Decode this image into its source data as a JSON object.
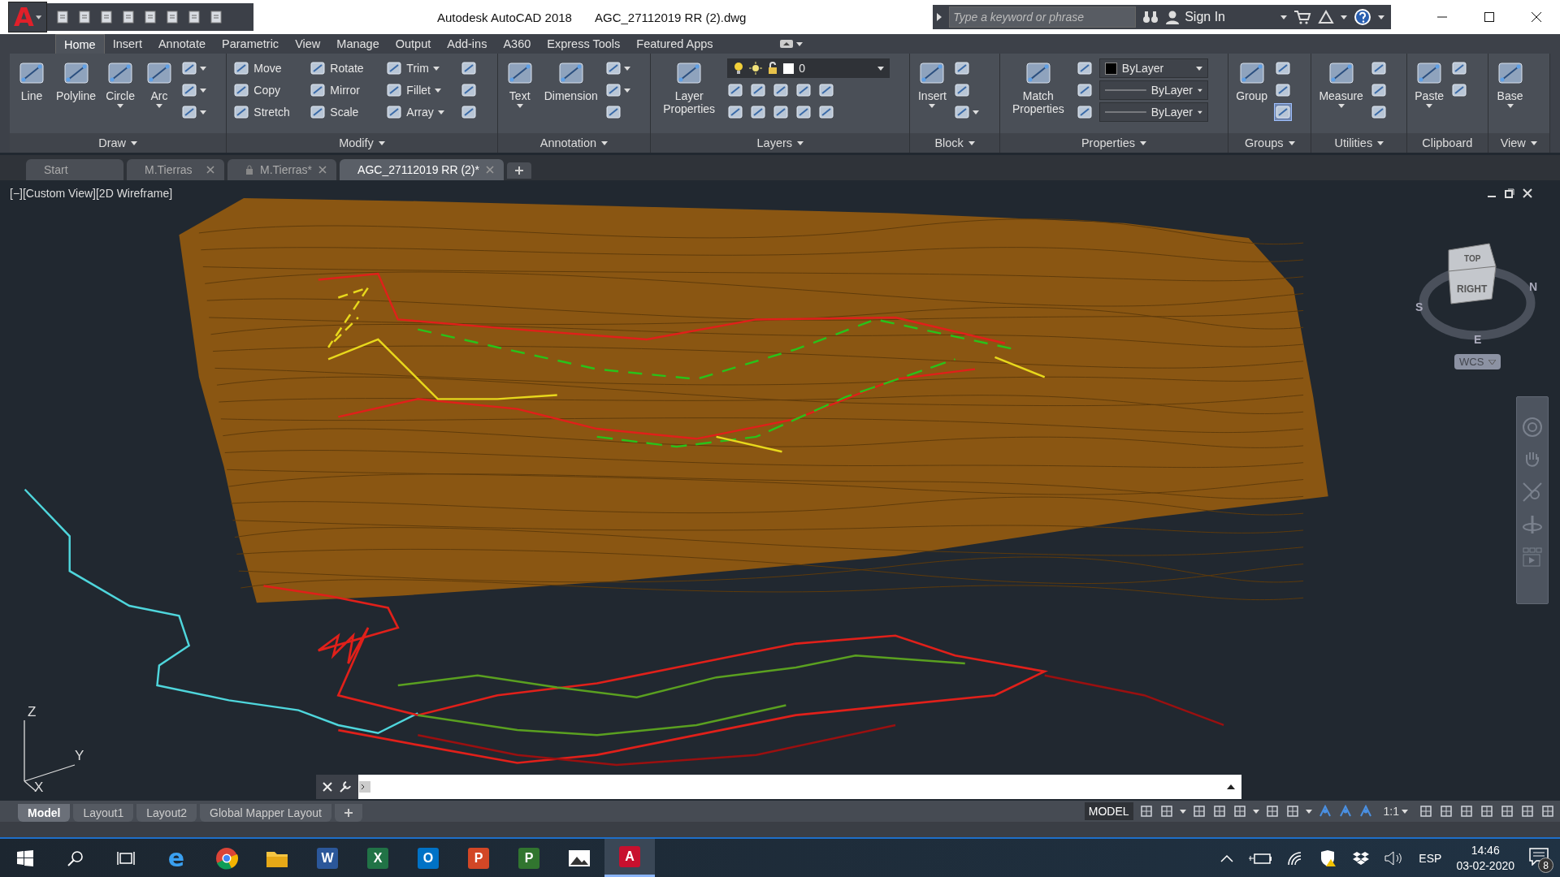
{
  "app_menu": {
    "letter": "A"
  },
  "window": {
    "title": "Autodesk AutoCAD 2018",
    "file": "AGC_27112019 RR (2).dwg"
  },
  "search": {
    "placeholder": "Type a keyword or phrase"
  },
  "account": {
    "label": "Sign In"
  },
  "ribbon_tabs": [
    {
      "label": "Home",
      "selected": true
    },
    {
      "label": "Insert",
      "selected": false
    },
    {
      "label": "Annotate",
      "selected": false
    },
    {
      "label": "Parametric",
      "selected": false
    },
    {
      "label": "View",
      "selected": false
    },
    {
      "label": "Manage",
      "selected": false
    },
    {
      "label": "Output",
      "selected": false
    },
    {
      "label": "Add-ins",
      "selected": false
    },
    {
      "label": "A360",
      "selected": false
    },
    {
      "label": "Express Tools",
      "selected": false
    },
    {
      "label": "Featured Apps",
      "selected": false
    }
  ],
  "ribbon_panels": [
    {
      "title": "Draw",
      "has_menu": true,
      "large": [
        {
          "label": "Line",
          "has_menu": false
        },
        {
          "label": "Polyline",
          "has_menu": false
        },
        {
          "label": "Circle",
          "has_menu": true
        },
        {
          "label": "Arc",
          "has_menu": true
        }
      ],
      "rows": [
        [
          {
            "kind": "icon",
            "has_menu": true
          }
        ],
        [
          {
            "kind": "icon",
            "has_menu": true
          }
        ],
        [
          {
            "kind": "icon",
            "has_menu": true
          }
        ]
      ]
    },
    {
      "title": "Modify",
      "has_menu": true,
      "rows": [
        [
          {
            "kind": "small",
            "label": "Move",
            "has_menu": false
          },
          {
            "kind": "small",
            "label": "Rotate",
            "has_menu": false
          },
          {
            "kind": "small",
            "label": "Trim",
            "has_menu": true
          },
          {
            "kind": "icon",
            "has_menu": false
          }
        ],
        [
          {
            "kind": "small",
            "label": "Copy",
            "has_menu": false
          },
          {
            "kind": "small",
            "label": "Mirror",
            "has_menu": false
          },
          {
            "kind": "small",
            "label": "Fillet",
            "has_menu": true
          },
          {
            "kind": "icon",
            "has_menu": false
          }
        ],
        [
          {
            "kind": "small",
            "label": "Stretch",
            "has_menu": false
          },
          {
            "kind": "small",
            "label": "Scale",
            "has_menu": false
          },
          {
            "kind": "small",
            "label": "Array",
            "has_menu": true
          },
          {
            "kind": "icon",
            "has_menu": false
          }
        ]
      ]
    },
    {
      "title": "Annotation",
      "has_menu": true,
      "large": [
        {
          "label": "Text",
          "has_menu": true
        },
        {
          "label": "Dimension",
          "has_menu": false
        }
      ],
      "rows": [
        [
          {
            "kind": "icon",
            "has_menu": true
          }
        ],
        [
          {
            "kind": "icon",
            "has_menu": true
          }
        ],
        [
          {
            "kind": "icon",
            "has_menu": false
          }
        ]
      ]
    },
    {
      "title": "Layers",
      "has_menu": true,
      "large": [
        {
          "label": "Layer Properties",
          "has_menu": false
        }
      ],
      "rows": [
        [
          {
            "kind": "layer_dropdown",
            "value": "0"
          }
        ],
        [
          {
            "kind": "icon",
            "has_menu": false
          },
          {
            "kind": "icon",
            "has_menu": false
          },
          {
            "kind": "icon",
            "has_menu": false
          },
          {
            "kind": "icon",
            "has_menu": false
          },
          {
            "kind": "icon",
            "has_menu": false
          }
        ],
        [
          {
            "kind": "icon",
            "has_menu": false
          },
          {
            "kind": "icon",
            "has_menu": false
          },
          {
            "kind": "icon",
            "has_menu": false
          },
          {
            "kind": "icon",
            "has_menu": false
          },
          {
            "kind": "icon",
            "has_menu": false
          }
        ]
      ]
    },
    {
      "title": "Block",
      "has_menu": true,
      "large": [
        {
          "label": "Insert",
          "has_menu": true
        }
      ],
      "rows": [
        [
          {
            "kind": "icon",
            "has_menu": false
          }
        ],
        [
          {
            "kind": "icon",
            "has_menu": false
          }
        ],
        [
          {
            "kind": "icon",
            "has_menu": true
          }
        ]
      ]
    },
    {
      "title": "Properties",
      "has_menu": true,
      "large": [
        {
          "label": "Match Properties",
          "has_menu": false
        }
      ],
      "rows": [
        [
          {
            "kind": "icon",
            "has_menu": false
          },
          {
            "kind": "swatch_dropdown",
            "value": "ByLayer"
          }
        ],
        [
          {
            "kind": "icon",
            "has_menu": false
          },
          {
            "kind": "line_dropdown",
            "value": "ByLayer"
          }
        ],
        [
          {
            "kind": "icon",
            "has_menu": false
          },
          {
            "kind": "line_dropdown",
            "value": "ByLayer"
          }
        ]
      ]
    },
    {
      "title": "Groups",
      "has_menu": true,
      "large": [
        {
          "label": "Group",
          "has_menu": false
        }
      ],
      "rows": [
        [
          {
            "kind": "icon",
            "has_menu": false,
            "on": false
          }
        ],
        [
          {
            "kind": "icon",
            "has_menu": false,
            "on": false
          }
        ],
        [
          {
            "kind": "icon",
            "has_menu": false,
            "on": true
          }
        ]
      ]
    },
    {
      "title": "Utilities",
      "has_menu": true,
      "large": [
        {
          "label": "Measure",
          "has_menu": true
        }
      ],
      "rows": [
        [
          {
            "kind": "icon",
            "has_menu": false
          }
        ],
        [
          {
            "kind": "icon",
            "has_menu": false
          }
        ],
        [
          {
            "kind": "icon",
            "has_menu": false
          }
        ]
      ]
    },
    {
      "title": "Clipboard",
      "has_menu": false,
      "large": [
        {
          "label": "Paste",
          "has_menu": true
        }
      ],
      "rows": [
        [
          {
            "kind": "icon",
            "has_menu": false
          }
        ],
        [
          {
            "kind": "icon",
            "has_menu": false
          }
        ]
      ]
    },
    {
      "title": "View",
      "has_menu": true,
      "large": [
        {
          "label": "Base",
          "has_menu": true
        }
      ]
    }
  ],
  "file_tabs": [
    {
      "label": "Start",
      "selected": false,
      "closable": false,
      "locked": false
    },
    {
      "label": "M.Tierras",
      "selected": false,
      "closable": true,
      "locked": false
    },
    {
      "label": "M.Tierras*",
      "selected": false,
      "closable": true,
      "locked": true
    },
    {
      "label": "AGC_27112019 RR (2)*",
      "selected": true,
      "closable": true,
      "locked": false
    }
  ],
  "viewport": {
    "controls": "[−][Custom View][2D Wireframe]",
    "viewcube": {
      "top": "TOP",
      "front": "RIGHT",
      "south": "S",
      "north": "N",
      "east": "E",
      "ucs": "WCS"
    },
    "axes": {
      "z": "Z",
      "y": "Y",
      "x": "X"
    }
  },
  "layout_tabs": [
    {
      "label": "Model",
      "selected": true
    },
    {
      "label": "Layout1",
      "selected": false
    },
    {
      "label": "Layout2",
      "selected": false
    },
    {
      "label": "Global Mapper Layout",
      "selected": false
    }
  ],
  "status_bar": {
    "space": "MODEL",
    "scale": "1:1"
  },
  "taskbar": {
    "apps": [
      {
        "kind": "edge",
        "letter": "e",
        "selected": false
      },
      {
        "kind": "chrome",
        "selected": false
      },
      {
        "kind": "folder",
        "selected": false
      },
      {
        "kind": "tile",
        "letter": "W",
        "color": "#2b579a",
        "selected": false
      },
      {
        "kind": "tile",
        "letter": "X",
        "color": "#217346",
        "selected": false
      },
      {
        "kind": "tile",
        "letter": "O",
        "color": "#0072c6",
        "selected": false
      },
      {
        "kind": "tile",
        "letter": "P",
        "color": "#d24726",
        "selected": false
      },
      {
        "kind": "tile",
        "letter": "P",
        "color": "#31752f",
        "selected": false
      },
      {
        "kind": "photos",
        "selected": false
      },
      {
        "kind": "tile",
        "letter": "A",
        "color": "#c8102e",
        "selected": true
      }
    ],
    "language": "ESP",
    "time": "14:46",
    "date": "03-02-2020",
    "notifications": "8"
  }
}
